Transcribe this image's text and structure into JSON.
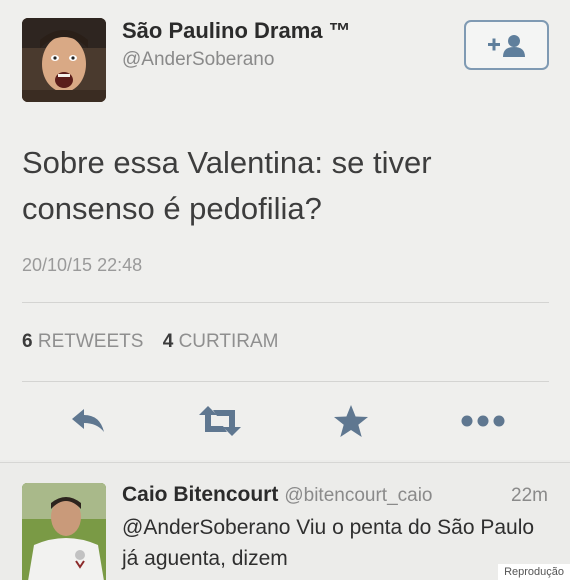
{
  "tweet": {
    "display_name": "São Paulino Drama ™",
    "handle": "@AnderSoberano",
    "text": "Sobre essa Valentina: se tiver consenso é pedofilia?",
    "timestamp": "20/10/15 22:48",
    "retweets_count": "6",
    "retweets_label": "RETWEETS",
    "likes_count": "4",
    "likes_label": "CURTIRAM"
  },
  "follow_button": {
    "icon": "add-user-icon",
    "color": "#7f9ab3"
  },
  "actions": [
    {
      "name": "reply",
      "icon": "reply-icon"
    },
    {
      "name": "retweet",
      "icon": "retweet-icon"
    },
    {
      "name": "favorite",
      "icon": "star-icon"
    },
    {
      "name": "more",
      "icon": "more-icon"
    }
  ],
  "icon_color": "#5f7790",
  "reply": {
    "display_name": "Caio Bitencourt",
    "handle": "@bitencourt_caio",
    "time": "22m",
    "text": "@AnderSoberano Viu o penta do São Paulo já aguenta, dizem"
  },
  "credit": "Reprodução"
}
